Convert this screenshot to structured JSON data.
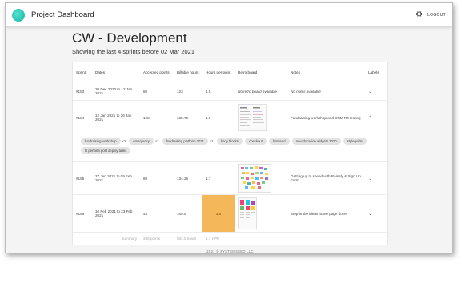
{
  "app": {
    "title": "Project Dashboard",
    "logout_label": "LOGOUT",
    "gear_icon": "gear-icon"
  },
  "page": {
    "title": "CW - Development",
    "subtitle": "Showing the last 4 sprints before 02 Mar 2021"
  },
  "table": {
    "headers": {
      "sprint": "Sprint",
      "dates": "Dates",
      "accepted": "Accepted points",
      "billable": "Billable hours",
      "hpp": "Hours per point",
      "retro": "Retro board",
      "notes": "Notes",
      "labels": "Labels"
    },
    "rows": [
      {
        "sprint": "#183",
        "dates": "30 Dec 2020 to 12 Jan 2021",
        "accepted": "80",
        "billable": "123",
        "hpp": "1.5",
        "retro_text": "No retro board available",
        "notes": "No notes available"
      },
      {
        "sprint": "#184",
        "dates": "12 Jan 2021 to 26 Jan 2021",
        "accepted": "128",
        "billable": "135.75",
        "hpp": "1.0",
        "notes": "Fundraising workshop and CRM R4 testing",
        "chips": [
          {
            "label": "fundraising workshop",
            "count": "x3"
          },
          {
            "label": "emergency",
            "count": "x2"
          },
          {
            "label": "fundraising platform 2021",
            "count": "x2"
          },
          {
            "label": "body blocks",
            "count": ""
          },
          {
            "label": "checkout",
            "count": ""
          },
          {
            "label": "frontend",
            "count": ""
          },
          {
            "label": "new donation widgets 2020",
            "count": ""
          },
          {
            "label": "styleguide",
            "count": ""
          },
          {
            "label": "ts perform post deploy tasks",
            "count": ""
          }
        ]
      },
      {
        "sprint": "#185",
        "dates": "27 Jan 2021 to 09 Feb 2021",
        "accepted": "80",
        "billable": "134.25",
        "hpp": "1.7",
        "notes": "Getting up to speed with Raisely & Sign Up Form"
      },
      {
        "sprint": "#186",
        "dates": "10 Feb 2021 to 23 Feb 2021",
        "accepted": "48",
        "billable": "169.5",
        "hpp": "3.5",
        "notes": "Step in the ideas home page done"
      }
    ],
    "summary": {
      "label": "Summary",
      "points": "336 points",
      "hours": "562.5 hours",
      "hpp": "1.7 HPP"
    }
  },
  "footer": {
    "text": "2021 © SYSTEMSEED LLC"
  },
  "colors": {
    "accent": "#1bc1b0",
    "highlight": "#f4b85a"
  }
}
